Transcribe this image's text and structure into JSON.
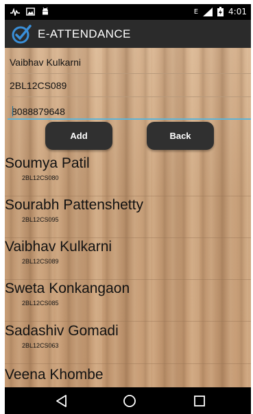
{
  "status_bar": {
    "time": "4:01",
    "network_type": "E",
    "left_icons": [
      "activity-icon",
      "image-icon",
      "android-icon"
    ],
    "right_icons": [
      "signal-icon",
      "battery-icon"
    ]
  },
  "app_bar": {
    "title": "E-ATTENDANCE",
    "logo": "checkmark-circle-icon"
  },
  "form": {
    "name_value": "Vaibhav Kulkarni",
    "usn_value": "2BL12CS089",
    "phone_value": "8088879648"
  },
  "buttons": {
    "add_label": "Add",
    "back_label": "Back"
  },
  "students": [
    {
      "name": "Soumya Patil",
      "usn": "2BL12CS080"
    },
    {
      "name": "Sourabh Pattenshetty",
      "usn": "2BL12CS095"
    },
    {
      "name": "Vaibhav Kulkarni",
      "usn": "2BL12CS089"
    },
    {
      "name": "Sweta Konkangaon",
      "usn": "2BL12CS085"
    },
    {
      "name": "Sadashiv Gomadi",
      "usn": "2BL12CS063"
    },
    {
      "name": "Veena Khombe",
      "usn": ""
    }
  ],
  "nav_bar": {
    "icons": [
      "back-triangle-icon",
      "home-circle-icon",
      "recents-square-icon"
    ]
  },
  "colors": {
    "app_bar": "#2b2b2b",
    "accent": "#5fb4d6",
    "button": "#303030",
    "background_wood": "#caa27c"
  }
}
